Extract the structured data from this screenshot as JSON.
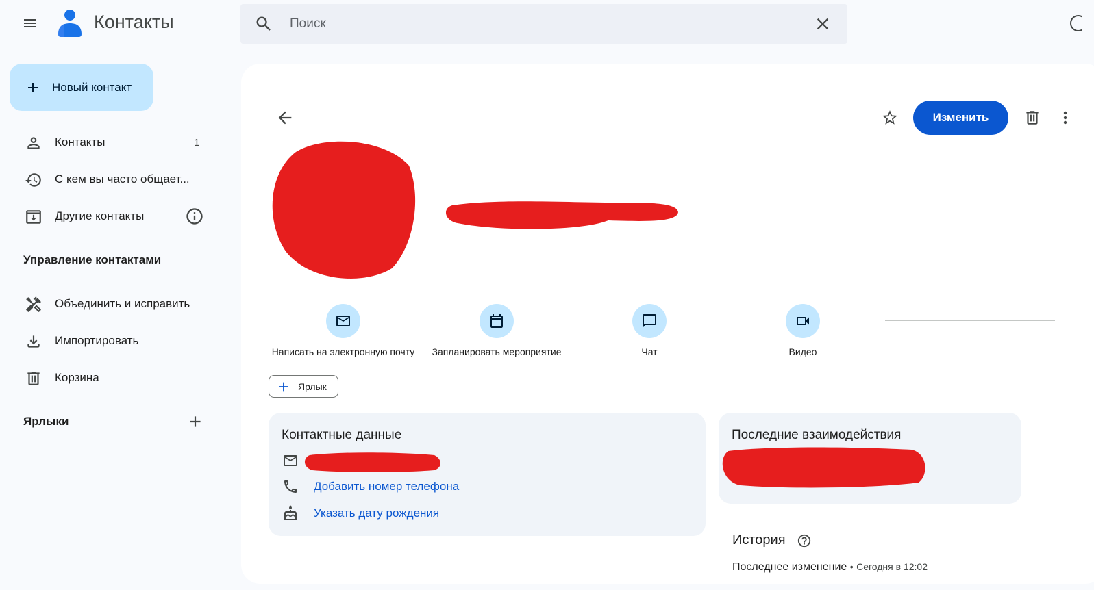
{
  "header": {
    "app_title": "Контакты",
    "search_placeholder": "Поиск"
  },
  "sidebar": {
    "new_contact_label": "Новый контакт",
    "items": [
      {
        "label": "Контакты",
        "count": "1",
        "icon": "person-icon"
      },
      {
        "label": "С кем вы часто общает...",
        "icon": "history-icon"
      },
      {
        "label": "Другие контакты",
        "icon": "archive-download-icon"
      }
    ],
    "manage_title": "Управление контактами",
    "manage_items": [
      {
        "label": "Объединить и исправить",
        "icon": "merge-tools-icon"
      },
      {
        "label": "Импортировать",
        "icon": "download-icon"
      },
      {
        "label": "Корзина",
        "icon": "trash-icon"
      }
    ],
    "labels_title": "Ярлыки"
  },
  "toolbar": {
    "edit_label": "Изменить"
  },
  "actions": [
    {
      "label": "Написать на электронную почту",
      "icon": "mail-icon"
    },
    {
      "label": "Запланировать мероприятие",
      "icon": "calendar-icon"
    },
    {
      "label": "Чат",
      "icon": "chat-icon"
    },
    {
      "label": "Видео",
      "icon": "video-icon"
    }
  ],
  "label_chip": "Ярлык",
  "contact_card": {
    "title": "Контактные данные",
    "add_phone": "Добавить номер телефона",
    "add_birthday": "Указать дату рождения"
  },
  "recent_card": {
    "title": "Последние взаимодействия"
  },
  "history": {
    "title": "История",
    "last_change_label": "Последнее изменение",
    "separator": "•",
    "last_change_time": "Сегодня в 12:02"
  },
  "colors": {
    "accent": "#0b57d0",
    "chip_bg": "#c2e7ff",
    "redaction": "#e61e1e"
  }
}
